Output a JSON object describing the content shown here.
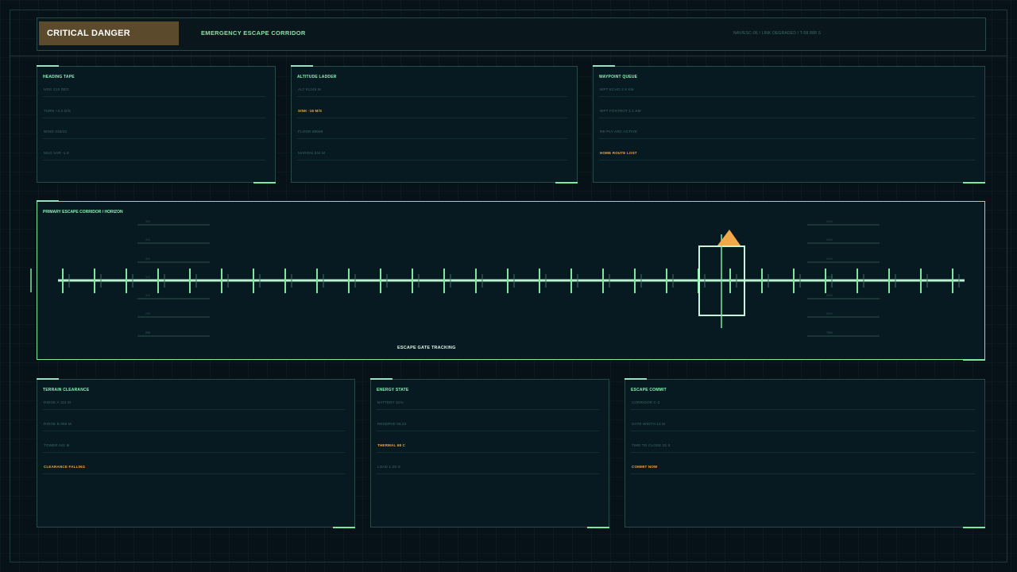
{
  "header": {
    "alert": "CRITICAL DANGER",
    "title": "EMERGENCY ESCAPE CORRIDOR",
    "meta": "NAV/ESC-06  /  LINK DEGRADED  /  T-58.888 S"
  },
  "panels_top": [
    {
      "title": "HEADING TAPE",
      "rows": [
        {
          "label": "HDG 219 DEG",
          "warn": false
        },
        {
          "label": "TURN +4.2 D/S",
          "warn": false
        },
        {
          "label": "WIND 316/42",
          "warn": false
        },
        {
          "label": "MAG VAR -1.8",
          "warn": false
        }
      ]
    },
    {
      "title": "ALTITUDE LADDER",
      "rows": [
        {
          "label": "ALT 81245 M",
          "warn": false
        },
        {
          "label": "SINK -18 M/S",
          "warn": true
        },
        {
          "label": "FLOOR 88699",
          "warn": false
        },
        {
          "label": "MARGIN 204 M",
          "warn": false
        }
      ]
    },
    {
      "title": "WAYPOINT QUEUE",
      "rows": [
        {
          "label": "WPT ECHO 2.9 KM",
          "warn": false
        },
        {
          "label": "WPT FOXTROT 4.1 KM",
          "warn": false
        },
        {
          "label": "RE-PLY ARC ACTIVE",
          "warn": false
        },
        {
          "label": "HOME ROUTE LOST",
          "warn": true
        }
      ]
    }
  ],
  "corridor": {
    "title": "PRIMARY ESCAPE CORRIDOR / HORIZON",
    "caption": "ESCAPE GATE TRACKING",
    "left_scale": [
      "350",
      "340",
      "330",
      "320",
      "310",
      "290",
      "280",
      "270"
    ],
    "right_scale": [
      "4000",
      "4500",
      "5000",
      "5500",
      "6000",
      "6500",
      "7000",
      "7500"
    ]
  },
  "panels_bottom": [
    {
      "title": "TERRAIN CLEARANCE",
      "rows": [
        {
          "label": "RIDGE A 112 M",
          "warn": false
        },
        {
          "label": "RIDGE B 086 M",
          "warn": false
        },
        {
          "label": "TOWER 041 M",
          "warn": false
        },
        {
          "label": "CLEARANCE FALLING",
          "warn": true
        }
      ]
    },
    {
      "title": "ENERGY STATE",
      "rows": [
        {
          "label": "BATTERY 31%",
          "warn": false
        },
        {
          "label": "RESERVE 06:42",
          "warn": false
        },
        {
          "label": "THERMAL 68 C",
          "warn": true
        },
        {
          "label": "LOAD 1.26 G",
          "warn": false
        }
      ]
    },
    {
      "title": "ESCAPE COMMIT",
      "rows": [
        {
          "label": "CORRIDOR C-3",
          "warn": false
        },
        {
          "label": "GATE WIDTH 14 M",
          "warn": false
        },
        {
          "label": "TIME TO CLOSE 22 S",
          "warn": false
        },
        {
          "label": "COMMIT NOW",
          "warn": true
        }
      ]
    }
  ],
  "colors": {
    "accent": "#7ee8a0",
    "warning": "#f0a848",
    "danger_badge": "#5b4a2c",
    "background": "#071218"
  }
}
